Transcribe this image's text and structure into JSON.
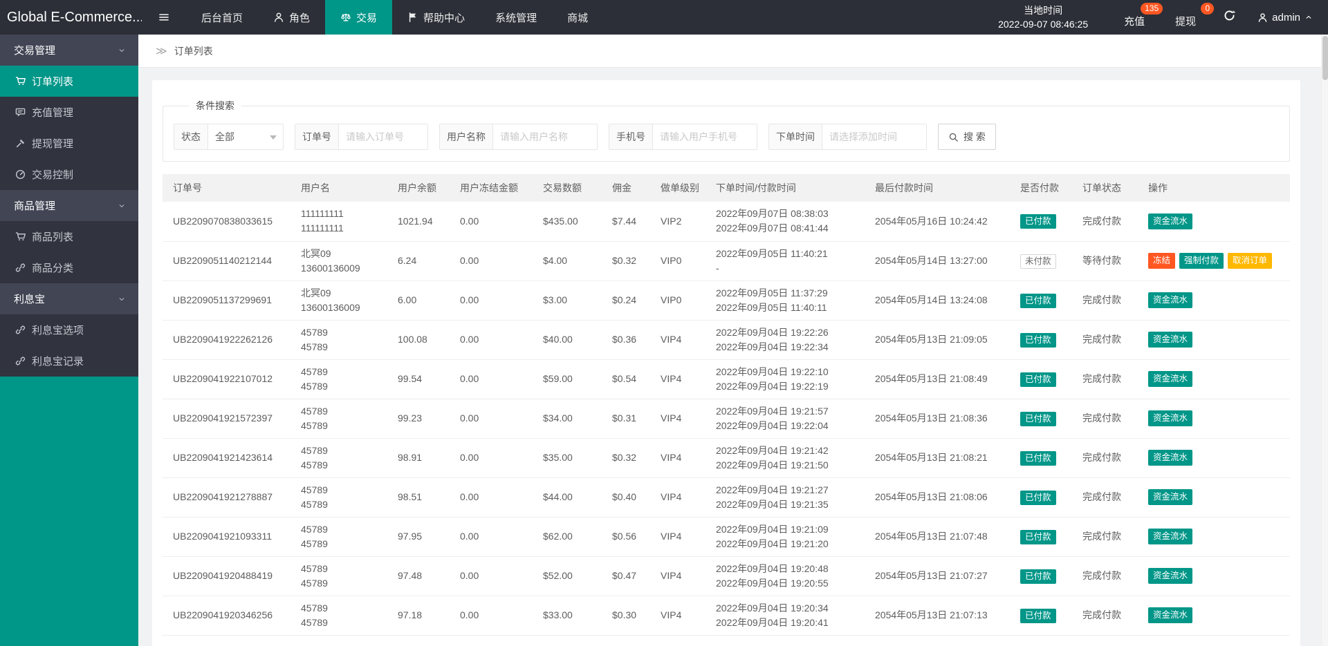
{
  "colors": {
    "accent": "#009688",
    "danger": "#FF5722",
    "warning": "#FFB800",
    "topbar_bg": "#2c2f37",
    "sidebar_bg": "#31343e"
  },
  "topbar": {
    "logo": "Global E-Commerce...",
    "nav": [
      {
        "label": "后台首页",
        "icon": null,
        "active": false
      },
      {
        "label": "角色",
        "icon": "person-icon",
        "active": false
      },
      {
        "label": "交易",
        "icon": "scales-icon",
        "active": true
      },
      {
        "label": "帮助中心",
        "icon": "flag-icon",
        "active": false
      },
      {
        "label": "系统管理",
        "icon": null,
        "active": false
      },
      {
        "label": "商城",
        "icon": null,
        "active": false
      }
    ],
    "local_time_label": "当地时间",
    "local_time_value": "2022-09-07 08:46:25",
    "links": [
      {
        "label": "充值",
        "badge": "135"
      },
      {
        "label": "提现",
        "badge": "0"
      }
    ],
    "user": {
      "name": "admin"
    }
  },
  "sidebar": {
    "groups": [
      {
        "title": "交易管理",
        "items": [
          {
            "label": "订单列表",
            "icon": "cart-icon",
            "active": true
          },
          {
            "label": "充值管理",
            "icon": "comment-icon",
            "active": false
          },
          {
            "label": "提现管理",
            "icon": "gavel-icon",
            "active": false
          },
          {
            "label": "交易控制",
            "icon": "gauge-icon",
            "active": false
          }
        ]
      },
      {
        "title": "商品管理",
        "items": [
          {
            "label": "商品列表",
            "icon": "cart-icon",
            "active": false
          },
          {
            "label": "商品分类",
            "icon": "link-icon",
            "active": false
          }
        ]
      },
      {
        "title": "利息宝",
        "items": [
          {
            "label": "利息宝选项",
            "icon": "link-icon",
            "active": false
          },
          {
            "label": "利息宝记录",
            "icon": "link-icon",
            "active": false
          }
        ]
      }
    ]
  },
  "breadcrumb": {
    "icon_glyph": "≫",
    "label": "订单列表"
  },
  "filter": {
    "legend": "条件搜索",
    "status_label": "状态",
    "status_value": "全部",
    "order_label": "订单号",
    "order_placeholder": "请输入订单号",
    "username_label": "用户名称",
    "username_placeholder": "请输入用户名称",
    "phone_label": "手机号",
    "phone_placeholder": "请输入用户手机号",
    "time_label": "下单时间",
    "time_placeholder": "请选择添加时间",
    "search_label": "搜 索"
  },
  "table": {
    "headers": [
      "订单号",
      "用户名",
      "用户余额",
      "用户冻结金额",
      "交易数额",
      "佣金",
      "做单级别",
      "下单时间/付款时间",
      "最后付款时间",
      "是否付款",
      "订单状态",
      "操作"
    ],
    "rows": [
      {
        "order_no": "UB2209070838033615",
        "user": [
          "111111111",
          "111111111"
        ],
        "balance": "1021.94",
        "frozen": "0.00",
        "amount": "$435.00",
        "commission": "$7.44",
        "level": "VIP2",
        "order_time": [
          "2022年09月07日 08:38:03",
          "2022年09月07日 08:41:44"
        ],
        "last_pay_time": "2054年05月16日 10:24:42",
        "paid": {
          "label": "已付款",
          "style": "paid"
        },
        "status": "完成付款",
        "actions": [
          {
            "label": "资金流水",
            "style": "teal"
          }
        ]
      },
      {
        "order_no": "UB2209051140212144",
        "user": [
          "北冥09",
          "13600136009"
        ],
        "balance": "6.24",
        "frozen": "0.00",
        "amount": "$4.00",
        "commission": "$0.32",
        "level": "VIP0",
        "order_time": [
          "2022年09月05日 11:40:21",
          "-"
        ],
        "last_pay_time": "2054年05月14日 13:27:00",
        "paid": {
          "label": "未付款",
          "style": "unpaid"
        },
        "status": "等待付款",
        "actions": [
          {
            "label": "冻结",
            "style": "red"
          },
          {
            "label": "强制付款",
            "style": "teal"
          },
          {
            "label": "取消订单",
            "style": "yellow"
          }
        ]
      },
      {
        "order_no": "UB2209051137299691",
        "user": [
          "北冥09",
          "13600136009"
        ],
        "balance": "6.00",
        "frozen": "0.00",
        "amount": "$3.00",
        "commission": "$0.24",
        "level": "VIP0",
        "order_time": [
          "2022年09月05日 11:37:29",
          "2022年09月05日 11:40:11"
        ],
        "last_pay_time": "2054年05月14日 13:24:08",
        "paid": {
          "label": "已付款",
          "style": "paid"
        },
        "status": "完成付款",
        "actions": [
          {
            "label": "资金流水",
            "style": "teal"
          }
        ]
      },
      {
        "order_no": "UB2209041922262126",
        "user": [
          "45789",
          "45789"
        ],
        "balance": "100.08",
        "frozen": "0.00",
        "amount": "$40.00",
        "commission": "$0.36",
        "level": "VIP4",
        "order_time": [
          "2022年09月04日 19:22:26",
          "2022年09月04日 19:22:34"
        ],
        "last_pay_time": "2054年05月13日 21:09:05",
        "paid": {
          "label": "已付款",
          "style": "paid"
        },
        "status": "完成付款",
        "actions": [
          {
            "label": "资金流水",
            "style": "teal"
          }
        ]
      },
      {
        "order_no": "UB2209041922107012",
        "user": [
          "45789",
          "45789"
        ],
        "balance": "99.54",
        "frozen": "0.00",
        "amount": "$59.00",
        "commission": "$0.54",
        "level": "VIP4",
        "order_time": [
          "2022年09月04日 19:22:10",
          "2022年09月04日 19:22:19"
        ],
        "last_pay_time": "2054年05月13日 21:08:49",
        "paid": {
          "label": "已付款",
          "style": "paid"
        },
        "status": "完成付款",
        "actions": [
          {
            "label": "资金流水",
            "style": "teal"
          }
        ]
      },
      {
        "order_no": "UB2209041921572397",
        "user": [
          "45789",
          "45789"
        ],
        "balance": "99.23",
        "frozen": "0.00",
        "amount": "$34.00",
        "commission": "$0.31",
        "level": "VIP4",
        "order_time": [
          "2022年09月04日 19:21:57",
          "2022年09月04日 19:22:04"
        ],
        "last_pay_time": "2054年05月13日 21:08:36",
        "paid": {
          "label": "已付款",
          "style": "paid"
        },
        "status": "完成付款",
        "actions": [
          {
            "label": "资金流水",
            "style": "teal"
          }
        ]
      },
      {
        "order_no": "UB2209041921423614",
        "user": [
          "45789",
          "45789"
        ],
        "balance": "98.91",
        "frozen": "0.00",
        "amount": "$35.00",
        "commission": "$0.32",
        "level": "VIP4",
        "order_time": [
          "2022年09月04日 19:21:42",
          "2022年09月04日 19:21:50"
        ],
        "last_pay_time": "2054年05月13日 21:08:21",
        "paid": {
          "label": "已付款",
          "style": "paid"
        },
        "status": "完成付款",
        "actions": [
          {
            "label": "资金流水",
            "style": "teal"
          }
        ]
      },
      {
        "order_no": "UB2209041921278887",
        "user": [
          "45789",
          "45789"
        ],
        "balance": "98.51",
        "frozen": "0.00",
        "amount": "$44.00",
        "commission": "$0.40",
        "level": "VIP4",
        "order_time": [
          "2022年09月04日 19:21:27",
          "2022年09月04日 19:21:35"
        ],
        "last_pay_time": "2054年05月13日 21:08:06",
        "paid": {
          "label": "已付款",
          "style": "paid"
        },
        "status": "完成付款",
        "actions": [
          {
            "label": "资金流水",
            "style": "teal"
          }
        ]
      },
      {
        "order_no": "UB2209041921093311",
        "user": [
          "45789",
          "45789"
        ],
        "balance": "97.95",
        "frozen": "0.00",
        "amount": "$62.00",
        "commission": "$0.56",
        "level": "VIP4",
        "order_time": [
          "2022年09月04日 19:21:09",
          "2022年09月04日 19:21:20"
        ],
        "last_pay_time": "2054年05月13日 21:07:48",
        "paid": {
          "label": "已付款",
          "style": "paid"
        },
        "status": "完成付款",
        "actions": [
          {
            "label": "资金流水",
            "style": "teal"
          }
        ]
      },
      {
        "order_no": "UB2209041920488419",
        "user": [
          "45789",
          "45789"
        ],
        "balance": "97.48",
        "frozen": "0.00",
        "amount": "$52.00",
        "commission": "$0.47",
        "level": "VIP4",
        "order_time": [
          "2022年09月04日 19:20:48",
          "2022年09月04日 19:20:55"
        ],
        "last_pay_time": "2054年05月13日 21:07:27",
        "paid": {
          "label": "已付款",
          "style": "paid"
        },
        "status": "完成付款",
        "actions": [
          {
            "label": "资金流水",
            "style": "teal"
          }
        ]
      },
      {
        "order_no": "UB2209041920346256",
        "user": [
          "45789",
          "45789"
        ],
        "balance": "97.18",
        "frozen": "0.00",
        "amount": "$33.00",
        "commission": "$0.30",
        "level": "VIP4",
        "order_time": [
          "2022年09月04日 19:20:34",
          "2022年09月04日 19:20:41"
        ],
        "last_pay_time": "2054年05月13日 21:07:13",
        "paid": {
          "label": "已付款",
          "style": "paid"
        },
        "status": "完成付款",
        "actions": [
          {
            "label": "资金流水",
            "style": "teal"
          }
        ]
      }
    ]
  }
}
